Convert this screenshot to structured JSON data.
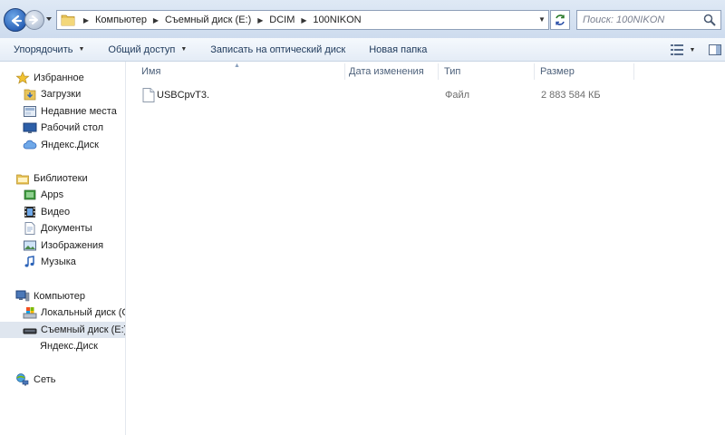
{
  "address_bar": {
    "breadcrumbs": [
      "Компьютер",
      "Съемный диск (E:)",
      "DCIM",
      "100NIKON"
    ],
    "search_placeholder": "Поиск: 100NIKON"
  },
  "toolbar": {
    "organize": "Упорядочить",
    "share": "Общий доступ",
    "burn": "Записать на оптический диск",
    "new_folder": "Новая папка"
  },
  "nav": {
    "favorites": "Избранное",
    "downloads": "Загрузки",
    "recent": "Недавние места",
    "desktop": "Рабочий стол",
    "yandex_disk_fav": "Яндекс.Диск",
    "libraries": "Библиотеки",
    "apps": "Apps",
    "video": "Видео",
    "documents": "Документы",
    "images": "Изображения",
    "music": "Музыка",
    "computer": "Компьютер",
    "local_disk": "Локальный диск (С",
    "removable_disk": "Съемный диск (E:)",
    "yandex_disk": "Яндекс.Диск",
    "network": "Сеть"
  },
  "columns": {
    "name": "Имя",
    "date_modified": "Дата изменения",
    "type": "Тип",
    "size": "Размер"
  },
  "files": [
    {
      "name": "USBCpvT3.",
      "date": "",
      "type": "Файл",
      "size": "2 883 584 КБ"
    }
  ],
  "colors": {
    "accent": "#2c63b8",
    "selection": "#dfe6ef",
    "toolbar_text": "#1e395b"
  }
}
